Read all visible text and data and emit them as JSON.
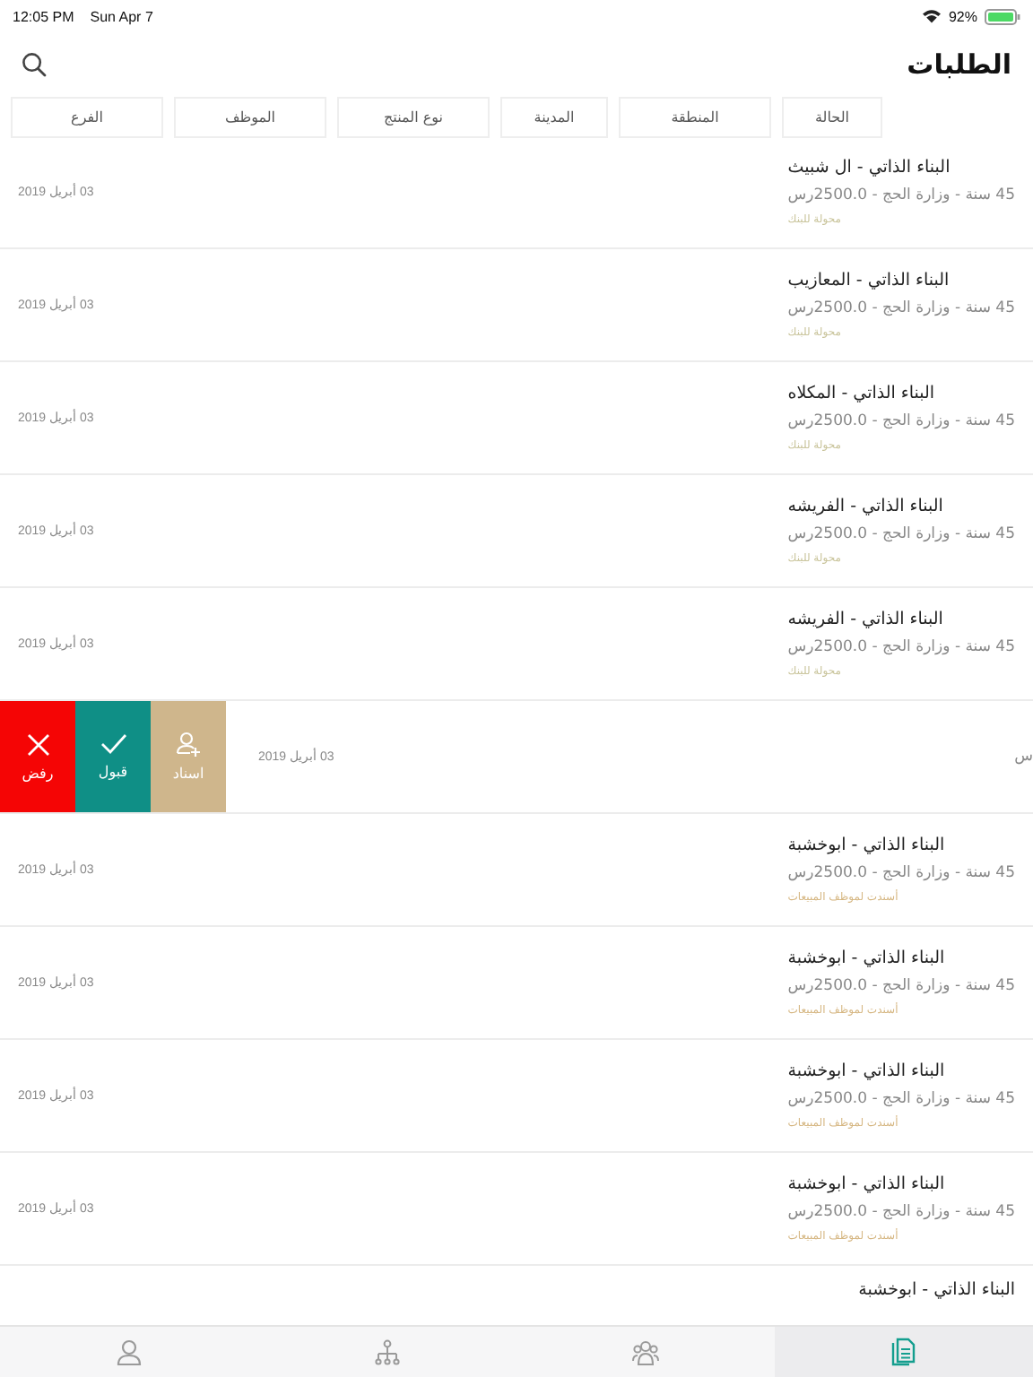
{
  "status_bar": {
    "time": "12:05 PM",
    "date": "Sun Apr 7",
    "battery": "92%"
  },
  "header": {
    "title": "الطلبات"
  },
  "filters": [
    {
      "label": "الحالة"
    },
    {
      "label": "المنطقة"
    },
    {
      "label": "المدينة"
    },
    {
      "label": "نوع المنتج"
    },
    {
      "label": "الموظف"
    },
    {
      "label": "الفرع"
    }
  ],
  "requests": [
    {
      "kind": "row",
      "title": "البناء الذاتي - ال شبيث",
      "subtitle": "45 سنة - وزارة الحج - 2500.0رس",
      "date": "03 أبريل 2019",
      "status": "محولة للبنك",
      "color": "#c9c49b"
    },
    {
      "kind": "row",
      "title": "البناء الذاتي - المعازيب",
      "subtitle": "45 سنة - وزارة الحج - 2500.0رس",
      "date": "03 أبريل 2019",
      "status": "محولة للبنك",
      "color": "#c9c49b"
    },
    {
      "kind": "row",
      "title": "البناء الذاتي - المكلاه",
      "subtitle": "45 سنة - وزارة الحج - 2500.0رس",
      "date": "03 أبريل 2019",
      "status": "محولة للبنك",
      "color": "#c9c49b"
    },
    {
      "kind": "row",
      "title": "البناء الذاتي - الفريشه",
      "subtitle": "45 سنة - وزارة الحج - 2500.0رس",
      "date": "03 أبريل 2019",
      "status": "محولة للبنك",
      "color": "#c9c49b"
    },
    {
      "kind": "row",
      "title": "البناء الذاتي - الفريشه",
      "subtitle": "45 سنة - وزارة الحج - 2500.0رس",
      "date": "03 أبريل 2019",
      "status": "محولة للبنك",
      "color": "#c9c49b"
    },
    {
      "kind": "swiped",
      "date": "03 أبريل 2019",
      "subtitle": "س",
      "actions": [
        {
          "kind": "assign",
          "label": "اسناد"
        },
        {
          "kind": "accept",
          "label": "قبول"
        },
        {
          "kind": "reject",
          "label": "رفض"
        }
      ]
    },
    {
      "kind": "row",
      "title": "البناء الذاتي - ابوخشبة",
      "subtitle": "45 سنة - وزارة الحج - 2500.0رس",
      "date": "03 أبريل 2019",
      "status": "أسندت لموظف المبيعات",
      "color": "#d6b783"
    },
    {
      "kind": "row",
      "title": "البناء الذاتي - ابوخشبة",
      "subtitle": "45 سنة - وزارة الحج - 2500.0رس",
      "date": "03 أبريل 2019",
      "status": "أسندت لموظف المبيعات",
      "color": "#d6b783"
    },
    {
      "kind": "row",
      "title": "البناء الذاتي - ابوخشبة",
      "subtitle": "45 سنة - وزارة الحج - 2500.0رس",
      "date": "03 أبريل 2019",
      "status": "أسندت لموظف المبيعات",
      "color": "#d6b783"
    },
    {
      "kind": "row",
      "title": "البناء الذاتي - ابوخشبة",
      "subtitle": "45 سنة - وزارة الحج - 2500.0رس",
      "date": "03 أبريل 2019",
      "status": "أسندت لموظف المبيعات",
      "color": "#d6b783"
    },
    {
      "kind": "row",
      "title": "البناء الذاتي - ابوخشبة"
    }
  ],
  "tab_bar": [
    {
      "kind": "profile",
      "selected": false
    },
    {
      "kind": "hierarchy",
      "selected": false
    },
    {
      "kind": "team",
      "selected": false
    },
    {
      "kind": "documents",
      "selected": true
    }
  ]
}
